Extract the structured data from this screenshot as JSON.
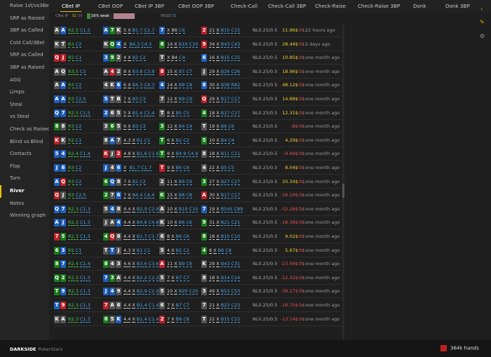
{
  "sidebar": {
    "items": [
      {
        "label": "Raise 1st/vs3Bet",
        "active": false
      },
      {
        "label": "SRP as Raised",
        "active": false
      },
      {
        "label": "3BP as Called",
        "active": false
      },
      {
        "label": "Cold Call/3Bet",
        "active": false
      },
      {
        "label": "SRP as Called",
        "active": false
      },
      {
        "label": "3BP as Raised",
        "active": false
      },
      {
        "label": "AGG",
        "active": false
      },
      {
        "label": "Limps",
        "active": false
      },
      {
        "label": "Steal",
        "active": false
      },
      {
        "label": "vs Steal",
        "active": false
      },
      {
        "label": "Check as Raised",
        "active": false
      },
      {
        "label": "Blind vs Blind",
        "active": false
      },
      {
        "label": "Contacts",
        "active": false
      },
      {
        "label": "Flop",
        "active": false
      },
      {
        "label": "Turn",
        "active": false
      },
      {
        "label": "River",
        "active": true
      },
      {
        "label": "Notes",
        "active": false
      },
      {
        "label": "Winning graph",
        "active": false
      }
    ]
  },
  "tabs": [
    "CBet IP",
    "CBet OOP",
    "CBet IP 3BP",
    "CBet OOP 3BP",
    "Check-Call",
    "Check-Call 3BP",
    "Check-Raise",
    "Check-Raise 3BP",
    "Donk",
    "Donk 3BP"
  ],
  "active_tab": "CBet IP",
  "filters": {
    "cbet_ip": "CBet IP",
    "s1": "S1",
    "s8": "S8",
    "range_label": "16% weak",
    "wssd": "WSSD",
    "wssd_value": "71"
  },
  "footer": {
    "brand": "DARKSIDE",
    "site": "PokerStars",
    "hands": "364k hands"
  },
  "colors": {
    "accent": "#e8c000",
    "hearts": "#c0202a",
    "diamonds": "#1f5fbf",
    "clubs": "#1a7d1a",
    "spades": "#555555"
  },
  "rows": [
    {
      "hole": [
        [
          "A",
          "s"
        ],
        [
          "A",
          "d"
        ]
      ],
      "pre": "R2.5",
      "pre2": "C1.5",
      "flop": [
        [
          "A",
          "d"
        ],
        [
          "7",
          "c"
        ],
        [
          "K",
          "s"
        ]
      ],
      "fa": "5",
      "ft": "X",
      "fb": "B1.7",
      "fc": "C1.7",
      "turn": [
        "7",
        "d"
      ],
      "ta": "X",
      "tb": "B6",
      "tc": "C6",
      "river": [
        "2",
        "h"
      ],
      "ra": "21",
      "rx": "X",
      "rb": "B15",
      "rc": "C15",
      "stake": "NL0.25/0.5",
      "net": "11.96$",
      "pos": true,
      "zero": "0$",
      "time": "22 hours ago"
    },
    {
      "hole": [
        [
          "K",
          "s"
        ],
        [
          "T",
          "s"
        ]
      ],
      "pre": "R3",
      "pre2": "C2",
      "flop": [
        [
          "K",
          "s"
        ],
        [
          "Q",
          "c"
        ],
        [
          "4",
          "d"
        ]
      ],
      "fa": "X",
      "ft": "",
      "fb": "B4.3",
      "fc": "C4.3",
      "turn": [
        "8",
        "c"
      ],
      "ta": "14",
      "tb": "X",
      "tc": "B10 C10",
      "river": [
        "9",
        "h"
      ],
      "ra": "34",
      "rx": "X",
      "rb": "B43",
      "rc": "C43",
      "stake": "NL0.25/0.5",
      "net": "28.44$",
      "pos": true,
      "zero": "0$",
      "time": "2 days ago"
    },
    {
      "hole": [
        [
          "Q",
          "h"
        ],
        [
          "J",
          "h"
        ]
      ],
      "pre": "R2",
      "pre2": "C1",
      "flop": [
        [
          "3",
          "d"
        ],
        [
          "9",
          "c"
        ],
        [
          "2",
          "s"
        ]
      ],
      "fa": "4",
      "ft": "X",
      "fb": "B2",
      "fc": "C2",
      "turn": [
        "T",
        "s"
      ],
      "ta": "X",
      "tb": "B4",
      "tc": "C4",
      "river": [
        "6",
        "d"
      ],
      "ra": "16",
      "rx": "X",
      "rb": "B15",
      "rc": "C15",
      "stake": "NL0.25/0.5",
      "net": "10.85$",
      "pos": true,
      "zero": "0$",
      "time": "one month ago"
    },
    {
      "hole": [
        [
          "A",
          "s"
        ],
        [
          "Q",
          "s"
        ]
      ],
      "pre": "R3.5",
      "pre2": "C3",
      "flop": [
        [
          "A",
          "s"
        ],
        [
          "4",
          "h"
        ],
        [
          "2",
          "s"
        ]
      ],
      "fa": "8",
      "ft": "X",
      "fb": "B3.8",
      "fc": "C3.8",
      "turn": [
        "8",
        "h"
      ],
      "ta": "15",
      "tb": "X",
      "tc": "B7 C7",
      "river": [
        "J",
        "s"
      ],
      "ra": "29",
      "rx": "X",
      "rb": "B26",
      "rc": "C26",
      "stake": "NL0.25/0.5",
      "net": "18.96$",
      "pos": true,
      "zero": "0$",
      "time": "one month ago"
    },
    {
      "hole": [
        [
          "A",
          "s"
        ],
        [
          "A",
          "d"
        ]
      ],
      "pre": "R3",
      "pre2": "C2",
      "flop": [
        [
          "4",
          "s"
        ],
        [
          "K",
          "s"
        ],
        [
          "6",
          "d"
        ]
      ],
      "fa": "6",
      "ft": "X",
      "fb": "B4.3",
      "fc": "C4.3",
      "turn": [
        "4",
        "d"
      ],
      "ta": "14",
      "tb": "X",
      "tc": "B8 C8",
      "river": [
        "8",
        "d"
      ],
      "ra": "30",
      "rx": "X",
      "rb": "B36",
      "rc": "R82",
      "stake": "NL0.25/0.5",
      "net": "48.12$",
      "pos": true,
      "zero": "0$",
      "time": "one month ago"
    },
    {
      "hole": [
        [
          "A",
          "d"
        ],
        [
          "A",
          "d"
        ]
      ],
      "pre": "R3",
      "pre2": "C2.5",
      "flop": [
        [
          "5",
          "d"
        ],
        [
          "T",
          "s"
        ],
        [
          "B",
          "s"
        ]
      ],
      "fa": "7",
      "ft": "X",
      "fb": "B3",
      "fc": "C3",
      "turn": [
        "7",
        "s"
      ],
      "ta": "12",
      "tb": "X",
      "tc": "B9 C9",
      "river": [
        "Q",
        "h"
      ],
      "ra": "29",
      "rx": "X",
      "rb": "B17",
      "rc": "C17",
      "stake": "NL0.25/0.5",
      "net": "14.88$",
      "pos": true,
      "zero": "0$",
      "time": "one month ago"
    },
    {
      "hole": [
        [
          "Q",
          "d"
        ],
        [
          "7",
          "d"
        ]
      ],
      "pre": "R2.5",
      "pre2": "C1.5",
      "flop": [
        [
          "2",
          "d"
        ],
        [
          "6",
          "s"
        ],
        [
          "5",
          "s"
        ]
      ],
      "fa": "5",
      "ft": "X",
      "fb": "B1.4",
      "fc": "C1.4",
      "turn": [
        "T",
        "s"
      ],
      "ta": "8",
      "tb": "X",
      "tc": "B5 C5",
      "river": [
        "4",
        "c"
      ],
      "ra": "18",
      "rx": "X",
      "rb": "B17",
      "rc": "C17",
      "stake": "NL0.25/0.5",
      "net": "12.31$",
      "pos": true,
      "zero": "0$",
      "time": "one month ago"
    },
    {
      "hole": [
        [
          "8",
          "c"
        ],
        [
          "8",
          "s"
        ]
      ],
      "pre": "R3",
      "pre2": "C2",
      "flop": [
        [
          "3",
          "s"
        ],
        [
          "6",
          "c"
        ],
        [
          "5",
          "s"
        ]
      ],
      "fa": "6",
      "ft": "X",
      "fb": "B3",
      "fc": "C3",
      "turn": [
        "3",
        "c"
      ],
      "ta": "12",
      "tb": "X",
      "tc": "B4 C4",
      "river": [
        "T",
        "s"
      ],
      "ra": "19",
      "rx": "X",
      "rb": "B6",
      "rc": "C6",
      "stake": "NL0.25/0.5",
      "net": "-8$",
      "pos": false,
      "zero": "0$",
      "time": "one month ago"
    },
    {
      "hole": [
        [
          "K",
          "h"
        ],
        [
          "K",
          "s"
        ]
      ],
      "pre": "R2",
      "pre2": "C1",
      "flop": [
        [
          "8",
          "s"
        ],
        [
          "A",
          "d"
        ],
        [
          "7",
          "s"
        ]
      ],
      "fa": "4.3",
      "ft": "X",
      "fb": "B1",
      "fc": "C1",
      "turn": [
        "T",
        "c"
      ],
      "ta": "6",
      "tb": "X",
      "tc": "B2 C2",
      "river": [
        "5",
        "c"
      ],
      "ra": "10",
      "rx": "X",
      "rb": "B4",
      "rc": "C4",
      "stake": "NL0.25/0.5",
      "net": "4.29$",
      "pos": true,
      "zero": "0$",
      "time": "one month ago"
    },
    {
      "hole": [
        [
          "5",
          "d"
        ],
        [
          "4",
          "d"
        ]
      ],
      "pre": "R2.4",
      "pre2": "C1.4",
      "flop": [
        [
          "K",
          "h"
        ],
        [
          "J",
          "s"
        ],
        [
          "2",
          "h"
        ]
      ],
      "fa": "4.8",
      "ft": "X",
      "fb": "B1.6",
      "fc": "C1.6",
      "turn": [
        "T",
        "c"
      ],
      "ta": "8",
      "tb": "X",
      "tc": "B4.9 C4.9",
      "river": [
        "8",
        "s"
      ],
      "ra": "18",
      "rx": "X",
      "rb": "B11",
      "rc": "C11",
      "stake": "NL0.25/0.5",
      "net": "-9.99$",
      "pos": false,
      "zero": "0$",
      "time": "one month ago"
    },
    {
      "hole": [
        [
          "J",
          "d"
        ],
        [
          "6",
          "d"
        ]
      ],
      "pre": "R3",
      "pre2": "C2",
      "flop": [
        [
          "J",
          "d"
        ],
        [
          "4",
          "s"
        ],
        [
          "6",
          "d"
        ]
      ],
      "fa": "X",
      "ft": "",
      "fb": "B1.7",
      "fc": "C1.7",
      "turn": [
        "T",
        "h"
      ],
      "ta": "9",
      "tb": "X",
      "tc": "B6 C6",
      "river": [
        "4",
        "s"
      ],
      "ra": "22",
      "rx": "X",
      "rb": "B5",
      "rc": "C5",
      "stake": "NL0.25/0.5",
      "net": "8.04$",
      "pos": true,
      "zero": "0$",
      "time": "one month ago"
    },
    {
      "hole": [
        [
          "A",
          "d"
        ],
        [
          "Q",
          "h"
        ]
      ],
      "pre": "R3",
      "pre2": "C2",
      "flop": [
        [
          "6",
          "c"
        ],
        [
          "Q",
          "d"
        ],
        [
          "8",
          "s"
        ]
      ],
      "fa": "7",
      "ft": "X",
      "fb": "B2",
      "fc": "C2",
      "turn": [
        "2",
        "s"
      ],
      "ta": "11",
      "tb": "X",
      "tc": "B9 C9",
      "river": [
        "3",
        "c"
      ],
      "ra": "27",
      "rx": "X",
      "rb": "B27",
      "rc": "C27",
      "stake": "NL0.25/0.5",
      "net": "20.34$",
      "pos": true,
      "zero": "0$",
      "time": "one month ago"
    },
    {
      "hole": [
        [
          "Q",
          "h"
        ],
        [
          "J",
          "s"
        ]
      ],
      "pre": "R3",
      "pre2": "C2.5",
      "flop": [
        [
          "2",
          "c"
        ],
        [
          "7",
          "s"
        ],
        [
          "6",
          "d"
        ]
      ],
      "fa": "7",
      "ft": "X",
      "fb": "B4.4",
      "fc": "C4.4",
      "turn": [
        "K",
        "c"
      ],
      "ta": "15",
      "tb": "X",
      "tc": "B8 C8",
      "river": [
        "A",
        "h"
      ],
      "ra": "30",
      "rx": "X",
      "rb": "B17",
      "rc": "C17",
      "stake": "NL0.25/0.5",
      "net": "-16.19$",
      "pos": false,
      "zero": "0$",
      "time": "one month ago"
    },
    {
      "hole": [
        [
          "Q",
          "d"
        ],
        [
          "7",
          "d"
        ]
      ],
      "pre": "R2.3",
      "pre2": "C1.3",
      "flop": [
        [
          "5",
          "s"
        ],
        [
          "4",
          "d"
        ],
        [
          "8",
          "s"
        ]
      ],
      "fa": "4.4",
      "ft": "X",
      "fb": "B2.9",
      "fc": "C2.9",
      "turn": [
        "A",
        "s"
      ],
      "ta": "10",
      "tb": "X",
      "tc": "B10 C10",
      "river": [
        "7",
        "d"
      ],
      "ra": "19",
      "rx": "X",
      "rb": "B545",
      "rc": "C89",
      "stake": "NL0.25/0.5",
      "net": "-52.28$",
      "pos": false,
      "zero": "0$",
      "time": "one month ago"
    },
    {
      "hole": [
        [
          "A",
          "d"
        ],
        [
          "J",
          "d"
        ]
      ],
      "pre": "R2.3",
      "pre2": "C1.3",
      "flop": [
        [
          "J",
          "s"
        ],
        [
          "A",
          "s"
        ],
        [
          "4",
          "d"
        ]
      ],
      "fa": "4.4",
      "ft": "X",
      "fb": "B4.8",
      "fc": "C4.8",
      "turn": [
        "K",
        "s"
      ],
      "ta": "10",
      "tb": "X",
      "tc": "B6 C6",
      "river": [
        "9",
        "c"
      ],
      "ra": "31",
      "rx": "X",
      "rb": "B21",
      "rc": "C21",
      "stake": "NL0.25/0.5",
      "net": "-18.38$",
      "pos": false,
      "zero": "0$",
      "time": "one month ago"
    },
    {
      "hole": [
        [
          "7",
          "h"
        ],
        [
          "5",
          "c"
        ]
      ],
      "pre": "R2.3",
      "pre2": "C1.3",
      "flop": [
        [
          "4",
          "c"
        ],
        [
          "Q",
          "h"
        ],
        [
          "8",
          "s"
        ]
      ],
      "fa": "4.4",
      "ft": "X",
      "fb": "B1.7",
      "fc": "C1.7",
      "turn": [
        "6",
        "s"
      ],
      "ta": "8",
      "tb": "X",
      "tc": "B6 C6",
      "river": [
        "8",
        "c"
      ],
      "ra": "18",
      "rx": "X",
      "rb": "B10",
      "rc": "C10",
      "stake": "NL0.25/0.5",
      "net": "9.02$",
      "pos": true,
      "zero": "0$",
      "time": "one month ago"
    },
    {
      "hole": [
        [
          "6",
          "c"
        ],
        [
          "3",
          "d"
        ]
      ],
      "pre": "R2",
      "pre2": "C1",
      "flop": [
        [
          "T",
          "s"
        ],
        [
          "T",
          "d"
        ],
        [
          "J",
          "s"
        ]
      ],
      "fa": "4.3",
      "ft": "X",
      "fb": "B1",
      "fc": "C1",
      "turn": [
        "5",
        "s"
      ],
      "ta": "4",
      "tb": "X",
      "tc": "B2 C2",
      "river": [
        "4",
        "c"
      ],
      "ra": "8",
      "rx": "X",
      "rb": "B8",
      "rc": "C8",
      "stake": "NL0.25/0.5",
      "net": "5.67$",
      "pos": true,
      "zero": "0$",
      "time": "one month ago"
    },
    {
      "hole": [
        [
          "8",
          "c"
        ],
        [
          "7",
          "d"
        ]
      ],
      "pre": "R2.4",
      "pre2": "C1.4",
      "flop": [
        [
          "8",
          "c"
        ],
        [
          "4",
          "s"
        ],
        [
          "3",
          "s"
        ]
      ],
      "fa": "4.6",
      "ft": "X",
      "fb": "B3.6",
      "fc": "C3.6",
      "turn": [
        "A",
        "h"
      ],
      "ta": "11",
      "tb": "X",
      "tc": "B9 C9",
      "river": [
        "K",
        "s"
      ],
      "ra": "29",
      "rx": "X",
      "rb": "B43",
      "rc": "C31",
      "stake": "NL0.25/0.5",
      "net": "-23.09$",
      "pos": false,
      "zero": "0$",
      "time": "one month ago"
    },
    {
      "hole": [
        [
          "Q",
          "c"
        ],
        [
          "2",
          "c"
        ]
      ],
      "pre": "R2.3",
      "pre2": "C1.3",
      "flop": [
        [
          "7",
          "d"
        ],
        [
          "3",
          "c"
        ],
        [
          "A",
          "s"
        ]
      ],
      "fa": "4.4",
      "ft": "X",
      "fb": "B2.2",
      "fc": "C2.2",
      "turn": [
        "5",
        "s"
      ],
      "ta": "7",
      "tb": "X",
      "tc": "B7 C7",
      "river": [
        "8",
        "s"
      ],
      "ra": "18",
      "rx": "X",
      "rb": "B14",
      "rc": "C14",
      "stake": "NL0.25/0.5",
      "net": "-12.32$",
      "pos": false,
      "zero": "0$",
      "time": "one month ago"
    },
    {
      "hole": [
        [
          "T",
          "c"
        ],
        [
          "9",
          "d"
        ]
      ],
      "pre": "R2.3",
      "pre2": "C1.3",
      "flop": [
        [
          "J",
          "d"
        ],
        [
          "4",
          "d"
        ],
        [
          "9",
          "s"
        ]
      ],
      "fa": "4.4",
      "ft": "X",
      "fb": "B2.9",
      "fc": "C2.9",
      "turn": [
        "5",
        "s"
      ],
      "ta": "10",
      "tb": "X",
      "tc": "B20 C20",
      "river": [
        "3",
        "s"
      ],
      "ra": "49",
      "rx": "X",
      "rb": "B53",
      "rc": "C53",
      "stake": "NL0.25/0.5",
      "net": "-39.27$",
      "pos": false,
      "zero": "0$",
      "time": "one month ago"
    },
    {
      "hole": [
        [
          "T",
          "d"
        ],
        [
          "9",
          "h"
        ]
      ],
      "pre": "R2.3",
      "pre2": "C1.3",
      "flop": [
        [
          "7",
          "h"
        ],
        [
          "A",
          "s"
        ],
        [
          "6",
          "s"
        ]
      ],
      "fa": "4.4",
      "ft": "X",
      "fb": "B1.4",
      "fc": "C1.4",
      "turn": [
        "6",
        "s"
      ],
      "ta": "7",
      "tb": "X",
      "tc": "B7 C7",
      "river": [
        "7",
        "s"
      ],
      "ra": "21",
      "rx": "X",
      "rb": "B23",
      "rc": "C23",
      "stake": "NL0.25/0.5",
      "net": "-16.75$",
      "pos": false,
      "zero": "0$",
      "time": "one month ago"
    },
    {
      "hole": [
        [
          "K",
          "s"
        ],
        [
          "A",
          "s"
        ]
      ],
      "pre": "R2.3",
      "pre2": "C1.3",
      "flop": [
        [
          "8",
          "c"
        ],
        [
          "5",
          "s"
        ],
        [
          "K",
          "d"
        ]
      ],
      "fa": "4.4",
      "ft": "X",
      "fb": "B1.4",
      "fc": "C1.4",
      "turn": [
        "2",
        "h"
      ],
      "ta": "7",
      "tb": "X",
      "tc": "B8 C8",
      "river": [
        "T",
        "s"
      ],
      "ra": "22",
      "rx": "X",
      "rb": "B15",
      "rc": "C15",
      "stake": "NL0.25/0.5",
      "net": "-13.14$",
      "pos": false,
      "zero": "0$",
      "time": "one month ago"
    }
  ]
}
